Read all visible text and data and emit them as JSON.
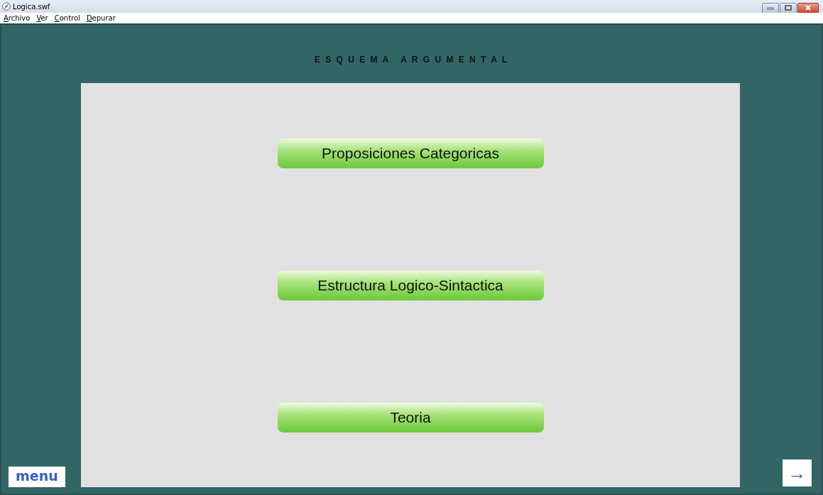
{
  "window": {
    "title": "Logica.swf"
  },
  "menu_bar": [
    "Archivo",
    "Ver",
    "Control",
    "Depurar"
  ],
  "heading": "E S Q U E M A   A R G U M E N T A L",
  "buttons": [
    {
      "label": "Proposiciones Categoricas"
    },
    {
      "label": "Estructura Logico-Sintactica"
    },
    {
      "label": "Teoria"
    }
  ],
  "menu_button": "menu",
  "next_button": "→"
}
